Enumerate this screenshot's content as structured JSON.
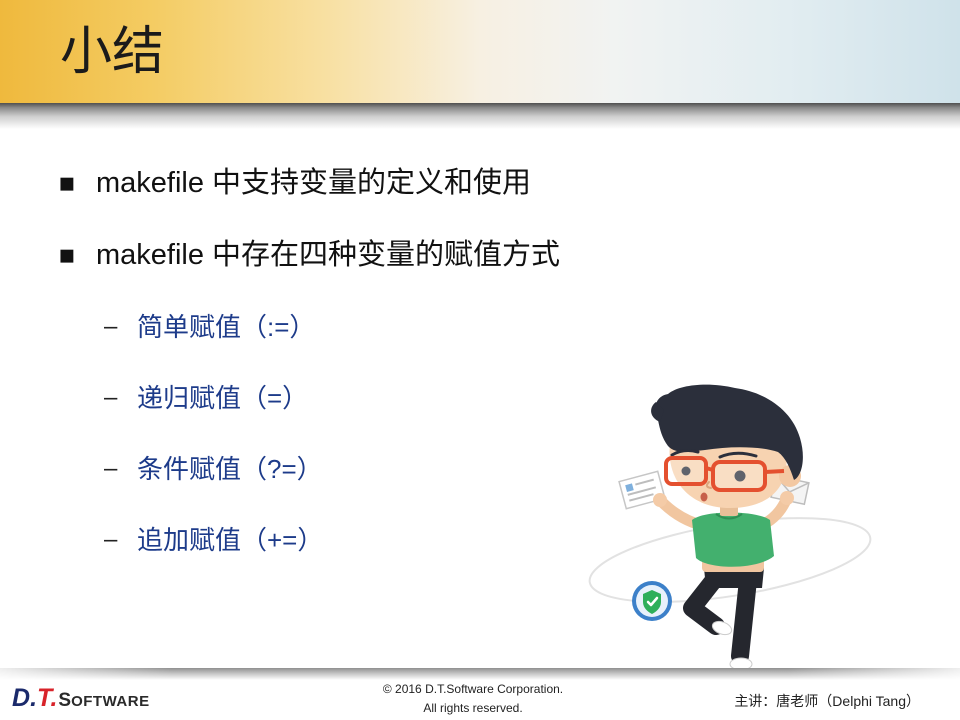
{
  "slide": {
    "title": "小结",
    "bullet_marker": "▪",
    "sub_bullet_marker": "–",
    "bullets": [
      "makefile 中支持变量的定义和使用",
      "makefile 中存在四种变量的赋值方式"
    ],
    "sub_bullets": [
      "简单赋值（:=）",
      "递归赋值（=）",
      "条件赋值（?=）",
      "追加赋值（+=）"
    ]
  },
  "footer": {
    "logo": {
      "d": "D",
      "dot1": ".",
      "t": "T",
      "dot2": ".",
      "s": "S",
      "oftware": "OFTWARE"
    },
    "copyright_line1": "© 2016 D.T.Software Corporation.",
    "copyright_line2": "All rights reserved.",
    "lecturer": "主讲：唐老师（Delphi Tang）"
  },
  "icons": {
    "badge": "shield-check-icon",
    "paper": "document-icon",
    "envelope": "envelope-icon"
  },
  "colors": {
    "header_gold": "#efb93d",
    "header_blue": "#cfe2ea",
    "sub_bullet_text": "#1d3b8a",
    "logo_navy": "#1b2a6b",
    "logo_red": "#d8232a",
    "shirt_green": "#43b06e",
    "glasses_red": "#e4502f"
  }
}
